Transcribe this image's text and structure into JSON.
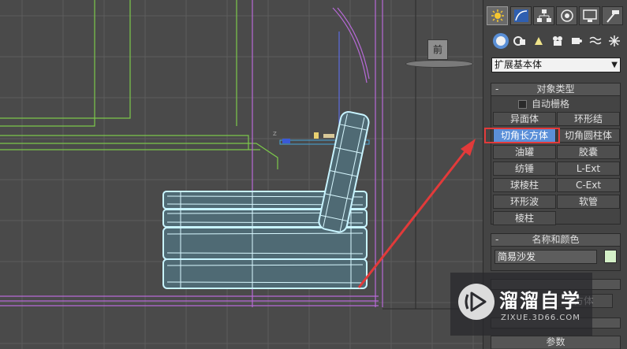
{
  "viewport": {
    "view_cube_label": "前"
  },
  "panel": {
    "tabs": [
      {
        "name": "create-tab",
        "icon": "sun-star-icon"
      },
      {
        "name": "modify-tab",
        "icon": "curve-icon"
      },
      {
        "name": "hierarchy-tab",
        "icon": "hierarchy-icon"
      },
      {
        "name": "motion-tab",
        "icon": "motion-icon"
      },
      {
        "name": "display-tab",
        "icon": "monitor-icon"
      },
      {
        "name": "utilities-tab",
        "icon": "hammer-icon"
      }
    ],
    "subcategory_icons": [
      "geometry-icon",
      "shapes-icon",
      "lights-icon",
      "cameras-icon",
      "helpers-icon",
      "spacewarps-icon",
      "systems-icon"
    ],
    "dropdown_value": "扩展基本体",
    "object_type": {
      "header": "对象类型",
      "minus": "-",
      "autogrid_label": "自动栅格",
      "buttons": [
        "异面体",
        "环形结",
        "切角长方体",
        "切角圆柱体",
        "油罐",
        "胶囊",
        "纺锤",
        "L-Ext",
        "球棱柱",
        "C-Ext",
        "环形波",
        "软管",
        "棱柱"
      ],
      "selected_button": "切角长方体"
    },
    "name_color": {
      "header": "名称和颜色",
      "minus": "-",
      "name_value": "简易沙发",
      "swatch_color": "#d4f0c8"
    },
    "partial_text": "方体",
    "params_header": "参数"
  },
  "annotation": {
    "highlight_color": "#e23a3a"
  },
  "watermark": {
    "title": "溜溜自学",
    "url": "ZIXUE.3D66.COM"
  }
}
